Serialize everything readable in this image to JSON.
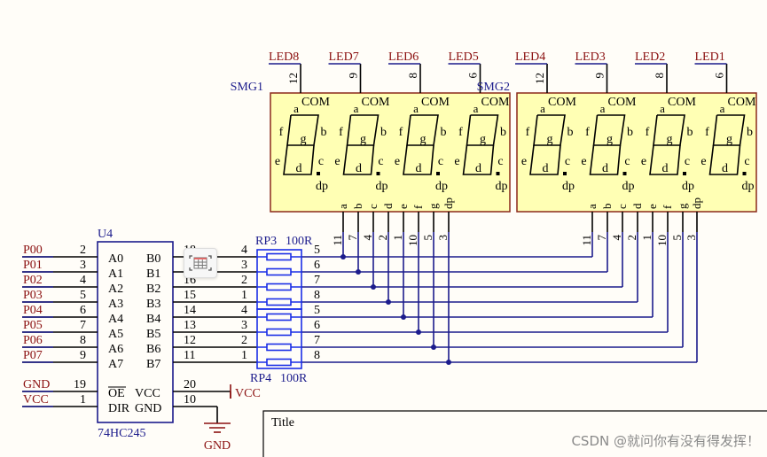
{
  "colors": {
    "wire": "#1c1c8c",
    "net_label": "#8b1010",
    "box_fill": "#ffffb4",
    "box_border": "#8b2a1a",
    "part": "#1c1c8c",
    "resistor": "#1a2ee6"
  },
  "displays": [
    {
      "ref": "SMG1",
      "digits": [
        {
          "net": "LED8",
          "pin": "12"
        },
        {
          "net": "LED7",
          "pin": "9"
        },
        {
          "net": "LED6",
          "pin": "8"
        },
        {
          "net": "LED5",
          "pin": "6"
        }
      ]
    },
    {
      "ref": "SMG2",
      "digits": [
        {
          "net": "LED4",
          "pin": "12"
        },
        {
          "net": "LED3",
          "pin": "9"
        },
        {
          "net": "LED2",
          "pin": "8"
        },
        {
          "net": "LED1",
          "pin": "6"
        }
      ]
    }
  ],
  "com_label": "COM",
  "segment_labels": {
    "a": "a",
    "b": "b",
    "c": "c",
    "d": "d",
    "e": "e",
    "f": "f",
    "g": "g",
    "dp": "dp"
  },
  "segment_pins": {
    "labels": [
      "a",
      "b",
      "c",
      "d",
      "e",
      "f",
      "g",
      "dp"
    ],
    "numbers": [
      "11",
      "7",
      "4",
      "2",
      "1",
      "10",
      "5",
      "3"
    ]
  },
  "u4": {
    "ref": "U4",
    "part": "74HC245",
    "a_nets": [
      "P00",
      "P01",
      "P02",
      "P03",
      "P04",
      "P05",
      "P06",
      "P07"
    ],
    "a_pins": [
      "2",
      "3",
      "4",
      "5",
      "6",
      "7",
      "8",
      "9"
    ],
    "a_labels": [
      "A0",
      "A1",
      "A2",
      "A3",
      "A4",
      "A5",
      "A6",
      "A7"
    ],
    "b_labels": [
      "B0",
      "B1",
      "B2",
      "B3",
      "B4",
      "B5",
      "B6",
      "B7"
    ],
    "b_pins": [
      "18",
      "17",
      "16",
      "15",
      "14",
      "13",
      "12",
      "11"
    ],
    "ctrl": [
      {
        "net": "GND",
        "pin": "19",
        "label": "OE"
      },
      {
        "net": "VCC",
        "pin": "1",
        "label": "DIR"
      }
    ],
    "power": [
      {
        "label": "VCC",
        "pin": "20",
        "net": "VCC"
      },
      {
        "label": "GND",
        "pin": "10",
        "net": "GND"
      }
    ]
  },
  "resistor_packs": [
    {
      "ref": "RP3",
      "value": "100R",
      "left_pins": [
        "4",
        "3",
        "2",
        "1"
      ],
      "right_pins": [
        "5",
        "6",
        "7",
        "8"
      ]
    },
    {
      "ref": "RP4",
      "value": "100R",
      "left_pins": [
        "4",
        "3",
        "2",
        "1"
      ],
      "right_pins": [
        "5",
        "6",
        "7",
        "8"
      ]
    }
  ],
  "title_block": {
    "label": "Title"
  },
  "watermark": "CSDN @就问你有没有得发挥！",
  "overlay_icon": "table-capture-icon"
}
